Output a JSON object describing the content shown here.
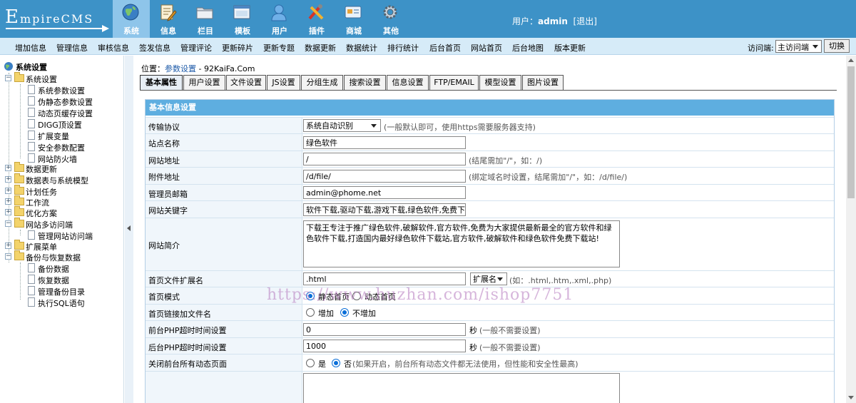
{
  "logo": {
    "text_E": "E",
    "text_rest": "mpireCMS"
  },
  "nav": [
    {
      "label": "系统",
      "icon": "globe-icon"
    },
    {
      "label": "信息",
      "icon": "document-edit-icon"
    },
    {
      "label": "栏目",
      "icon": "folder-icon"
    },
    {
      "label": "模板",
      "icon": "window-icon"
    },
    {
      "label": "用户",
      "icon": "user-icon"
    },
    {
      "label": "插件",
      "icon": "tools-icon"
    },
    {
      "label": "商城",
      "icon": "card-icon"
    },
    {
      "label": "其他",
      "icon": "gear-icon"
    }
  ],
  "user": {
    "prefix": "用户：",
    "name": "admin",
    "logout": "[退出]"
  },
  "menu": [
    "增加信息",
    "管理信息",
    "审核信息",
    "签发信息",
    "管理评论",
    "更新碎片",
    "更新专题",
    "数据更新",
    "数据统计",
    "排行统计",
    "后台首页",
    "网站首页",
    "后台地图",
    "版本更新"
  ],
  "visit": {
    "label": "访问端:",
    "selected": "主访问端",
    "button": "切换"
  },
  "sidebar": {
    "root": "系统设置",
    "items": [
      {
        "label": "系统设置"
      },
      {
        "label": "系统参数设置"
      },
      {
        "label": "伪静态参数设置"
      },
      {
        "label": "动态页缓存设置"
      },
      {
        "label": "DIGG顶设置"
      },
      {
        "label": "扩展变量"
      },
      {
        "label": "安全参数配置"
      },
      {
        "label": "网站防火墙"
      },
      {
        "label": "数据更新"
      },
      {
        "label": "数据表与系统模型"
      },
      {
        "label": "计划任务"
      },
      {
        "label": "工作流"
      },
      {
        "label": "优化方案"
      },
      {
        "label": "网站多访问端"
      },
      {
        "label": "管理网站访问端"
      },
      {
        "label": "扩展菜单"
      },
      {
        "label": "备份与恢复数据"
      },
      {
        "label": "备份数据"
      },
      {
        "label": "恢复数据"
      },
      {
        "label": "管理备份目录"
      },
      {
        "label": "执行SQL语句"
      }
    ]
  },
  "breadcrumb": {
    "prefix": "位置：",
    "link": "参数设置",
    "suffix": " - 92KaiFa.Com"
  },
  "tabs": [
    "基本属性",
    "用户设置",
    "文件设置",
    "JS设置",
    "分组生成",
    "搜索设置",
    "信息设置",
    "FTP/EMAIL",
    "模型设置",
    "图片设置"
  ],
  "form": {
    "header": "基本信息设置",
    "protocol": {
      "label": "传输协议",
      "value": "系统自动识别",
      "hint": "(一般默认即可，使用https需要服务器支持)"
    },
    "sitename": {
      "label": "站点名称",
      "value": "绿色软件"
    },
    "siteurl": {
      "label": "网站地址",
      "value": "/",
      "hint": "(结尾需加\"/\"，如：/)"
    },
    "fileurl": {
      "label": "附件地址",
      "value": "/d/file/",
      "hint": "(绑定域名时设置，结尾需加\"/\"，如：/d/file/)"
    },
    "email": {
      "label": "管理员邮箱",
      "value": "admin@phome.net"
    },
    "keywords": {
      "label": "网站关键字",
      "value": "软件下载,驱动下载,游戏下载,绿色软件,免费下载"
    },
    "intro": {
      "label": "网站简介",
      "value": "下载王专注于推广绿色软件,破解软件,官方软件,免费为大家提供最新最全的官方软件和绿色软件下载,打造国内最好绿色软件下载站,官方软件,破解软件和绿色软件免费下载站!"
    },
    "ext": {
      "label": "首页文件扩展名",
      "value": ".html",
      "select": "扩展名",
      "hint": "(如：.html,.htm,.xml,.php)"
    },
    "mode": {
      "label": "首页模式",
      "opt1": "静态首页",
      "opt2": "动态首页"
    },
    "linkname": {
      "label": "首页链接加文件名",
      "opt1": "增加",
      "opt2": "不增加"
    },
    "fronttimeout": {
      "label": "前台PHP超时时间设置",
      "value": "0",
      "unit": "秒",
      "hint": "(一般不需要设置)"
    },
    "backtimeout": {
      "label": "后台PHP超时时间设置",
      "value": "1000",
      "unit": "秒",
      "hint": "(一般不需要设置)"
    },
    "closedyn": {
      "label": "关闭前台所有动态页面",
      "opt1": "是",
      "opt2": "否",
      "hint": "(如果开启，前台所有动态文件都无法使用，但性能和安全性最高)"
    }
  },
  "watermark": "https://www.huzhan.com/ishop7751"
}
